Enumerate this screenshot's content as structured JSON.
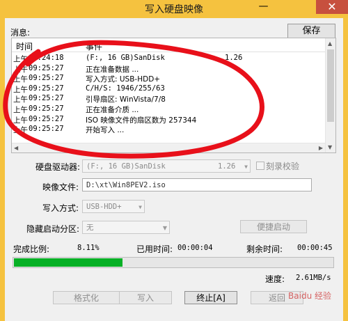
{
  "window": {
    "title": "写入硬盘映像",
    "minimize": "—",
    "close": "✕"
  },
  "messages": {
    "label": "消息:",
    "save": "保存",
    "columns": {
      "time": "时间",
      "event": "事件"
    },
    "rows": [
      {
        "period": "上午",
        "time": "09:24:18",
        "event": "(F:, 16 GB)SanDisk",
        "extra": "1.26"
      },
      {
        "period": "上午",
        "time": "09:25:27",
        "event": "正在准备数据 ...",
        "extra": ""
      },
      {
        "period": "上午",
        "time": "09:25:27",
        "event": "写入方式: USB-HDD+",
        "extra": ""
      },
      {
        "period": "上午",
        "time": "09:25:27",
        "event": "C/H/S: 1946/255/63",
        "extra": ""
      },
      {
        "period": "上午",
        "time": "09:25:27",
        "event": "引导扇区: WinVista/7/8",
        "extra": ""
      },
      {
        "period": "上午",
        "time": "09:25:27",
        "event": "正在准备介质 ...",
        "extra": ""
      },
      {
        "period": "上午",
        "time": "09:25:27",
        "event": "ISO 映像文件的扇区数为 257344",
        "extra": ""
      },
      {
        "period": "上午",
        "time": "09:25:27",
        "event": "开始写入 ...",
        "extra": ""
      }
    ]
  },
  "form": {
    "drive_label": "硬盘驱动器:",
    "drive_value": "(F:, 16 GB)SanDisk",
    "drive_version": "1.26",
    "verify_label": "刻录校验",
    "image_label": "映像文件:",
    "image_value": "D:\\xt\\Win8PEV2.iso",
    "method_label": "写入方式:",
    "method_value": "USB-HDD+",
    "hidden_label": "隐藏启动分区:",
    "hidden_value": "无",
    "quick_boot": "便捷启动"
  },
  "status": {
    "ratio_label": "完成比例:",
    "ratio_value": "8.11%",
    "progress": 0.0811,
    "elapsed_label": "已用时间:",
    "elapsed_value": "00:00:04",
    "remain_label": "剩余时间:",
    "remain_value": "00:00:45",
    "speed_label": "速度:",
    "speed_value": "2.61MB/s"
  },
  "buttons": {
    "format": "格式化",
    "write": "写入",
    "stop": "终止[A]",
    "back": "返回"
  },
  "watermark": "Baidu 经验",
  "colors": {
    "titlebar": "#f5c23f",
    "close": "#c7503e",
    "progress": "#06b025",
    "scribble": "#e8101a"
  }
}
